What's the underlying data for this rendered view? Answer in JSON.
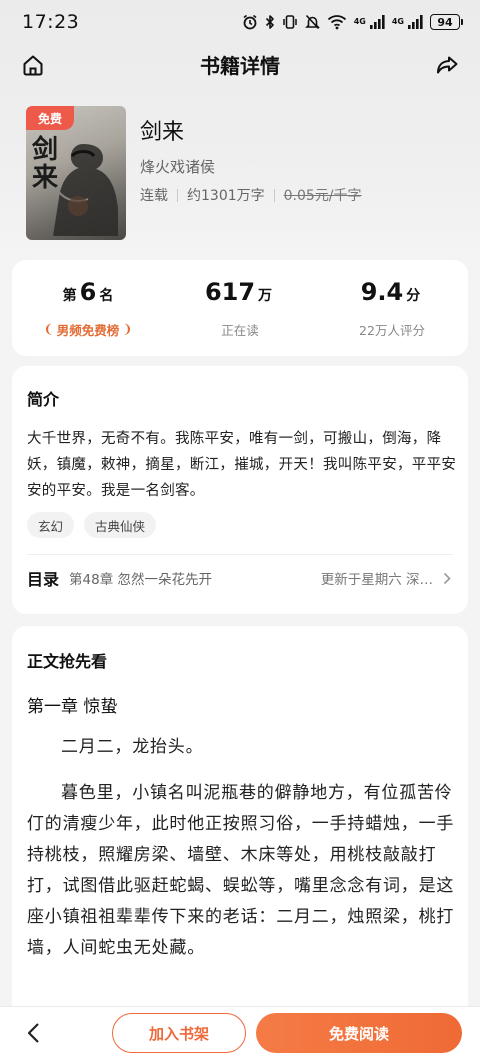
{
  "status_bar": {
    "time": "17:23",
    "battery": "94",
    "network_1": "4G",
    "network_2": "4G",
    "icons": [
      "alarm-icon",
      "bluetooth-icon",
      "vibrate-icon",
      "mute-icon",
      "wifi-icon",
      "signal-icon",
      "signal-icon",
      "battery-icon"
    ]
  },
  "nav": {
    "title": "书籍详情",
    "home_icon": "home-icon",
    "share_icon": "share-icon"
  },
  "book": {
    "badge": "免费",
    "cover_calligraphy": "剑来",
    "title": "剑来",
    "author": "烽火戏诸侯",
    "status": "连载",
    "word_count": "约1301万字",
    "price": "0.05元/千字"
  },
  "stats": {
    "rank_prefix": "第",
    "rank_value": "6",
    "rank_suffix": "名",
    "rank_list": "男频免费榜",
    "readers_value": "617",
    "readers_unit": "万",
    "readers_label": "正在读",
    "score_value": "9.4",
    "score_unit": "分",
    "score_label": "22万人评分"
  },
  "intro": {
    "heading": "简介",
    "text": "大千世界，无奇不有。我陈平安，唯有一剑，可搬山，倒海，降妖，镇魔，敕神，摘星，断江，摧城，开天！我叫陈平安，平平安安的平安。我是一名剑客。",
    "tags": [
      "玄幻",
      "古典仙侠"
    ]
  },
  "toc": {
    "label": "目录",
    "latest_chapter": "第48章 忽然一朵花先开",
    "updated": "更新于星期六 深…"
  },
  "preview": {
    "heading": "正文抢先看",
    "chapter_title": "第一章 惊蛰",
    "paragraphs": [
      "二月二，龙抬头。",
      "暮色里，小镇名叫泥瓶巷的僻静地方，有位孤苦伶仃的清瘦少年，此时他正按照习俗，一手持蜡烛，一手持桃枝，照耀房梁、墙壁、木床等处，用桃枝敲敲打打，试图借此驱赶蛇蝎、蜈蚣等，嘴里念念有词，是这座小镇祖祖辈辈传下来的老话：二月二，烛照梁，桃打墙，人间蛇虫无处藏。"
    ]
  },
  "bottom": {
    "back_icon": "back-icon",
    "add_shelf": "加入书架",
    "read_free": "免费阅读"
  },
  "colors": {
    "accent": "#ef6a35",
    "badge": "#ee5a4a",
    "rank": "#e26d36"
  }
}
